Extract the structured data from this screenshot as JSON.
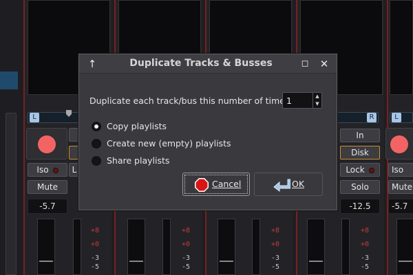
{
  "dialog": {
    "title": "Duplicate Tracks & Busses",
    "prompt": "Duplicate each track/bus this number of times:",
    "count_value": "1",
    "options": [
      {
        "label": "Copy playlists",
        "selected": true
      },
      {
        "label": "Create new (empty) playlists",
        "selected": false
      },
      {
        "label": "Share playlists",
        "selected": false
      }
    ],
    "cancel_label": "Cancel",
    "ok_label": "OK",
    "icons": {
      "up": "up-arrow-icon",
      "maximize": "maximize-icon",
      "close": "close-icon",
      "cancel": "stop-sign-icon",
      "ok": "return-arrow-icon"
    }
  },
  "mixer": {
    "left_strip": {
      "pan_left": "L",
      "iso_label": "Iso",
      "mute_label": "Mute",
      "gain": "-5.7"
    },
    "right_strip": {
      "pan_left": "L",
      "iso_label": "Iso",
      "mute_label": "Mute",
      "gain": "-5.7"
    },
    "center_right_strip": {
      "pan_right": "R",
      "in_label": "In",
      "disk_label": "Disk",
      "lock_label": "Lock",
      "solo_label": "Solo",
      "gain": "-12.5"
    },
    "partial_lock_label": "L",
    "scale_red": [
      "+8",
      "+0"
    ],
    "scale_gray": [
      "-3",
      "-5"
    ],
    "colors": {
      "record": "#f26464",
      "accent_blue": "#a8c6e6",
      "disk_border": "#c9902b",
      "meter_red": "#c23b3b"
    }
  }
}
